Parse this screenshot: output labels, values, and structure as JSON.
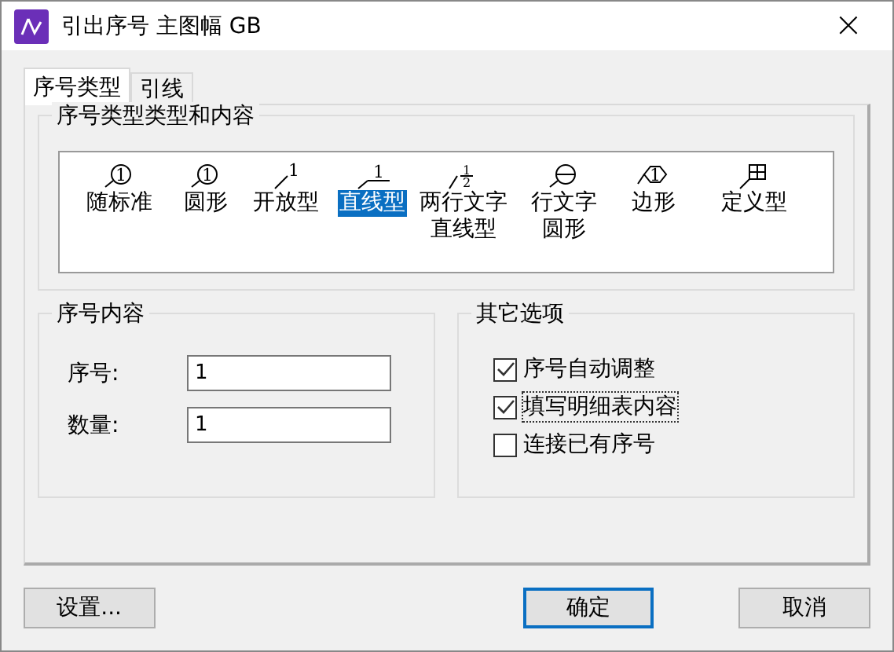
{
  "window": {
    "title": "引出序号 主图幅 GB",
    "close": "×"
  },
  "tabs": [
    {
      "label": "序号类型",
      "selected": true
    },
    {
      "label": "引线",
      "selected": false
    }
  ],
  "style_group": {
    "title": "序号类型类型和内容",
    "styles": [
      {
        "kind": "standard",
        "mark": "1",
        "lines": [
          "随标准"
        ],
        "selected": false
      },
      {
        "kind": "circle",
        "mark": "1",
        "lines": [
          "圆形"
        ],
        "selected": false
      },
      {
        "kind": "open",
        "mark": "1",
        "lines": [
          "开放型"
        ],
        "selected": false
      },
      {
        "kind": "line",
        "mark": "1",
        "lines": [
          "直线型"
        ],
        "selected": true
      },
      {
        "kind": "two-line",
        "mark": "1",
        "mark2": "2",
        "lines": [
          "两行文字",
          "直线型"
        ],
        "selected": false
      },
      {
        "kind": "two-line-circle",
        "lines": [
          "行文字",
          "圆形"
        ],
        "selected": false
      },
      {
        "kind": "polygon",
        "mark": "1",
        "lines": [
          "边形"
        ],
        "selected": false
      },
      {
        "kind": "custom",
        "lines": [
          "定义型"
        ],
        "selected": false
      }
    ]
  },
  "content_group": {
    "title": "序号内容",
    "fields": [
      {
        "label": "序号:",
        "value": "1"
      },
      {
        "label": "数量:",
        "value": "1"
      }
    ]
  },
  "options_group": {
    "title": "其它选项",
    "options": [
      {
        "label": "序号自动调整",
        "checked": true,
        "focused": false
      },
      {
        "label": "填写明细表内容",
        "checked": true,
        "focused": true
      },
      {
        "label": "连接已有序号",
        "checked": false,
        "focused": false
      }
    ]
  },
  "buttons": [
    {
      "label": "设置...",
      "default": false
    },
    {
      "label": "确定",
      "default": true
    },
    {
      "label": "取消",
      "default": false
    }
  ]
}
